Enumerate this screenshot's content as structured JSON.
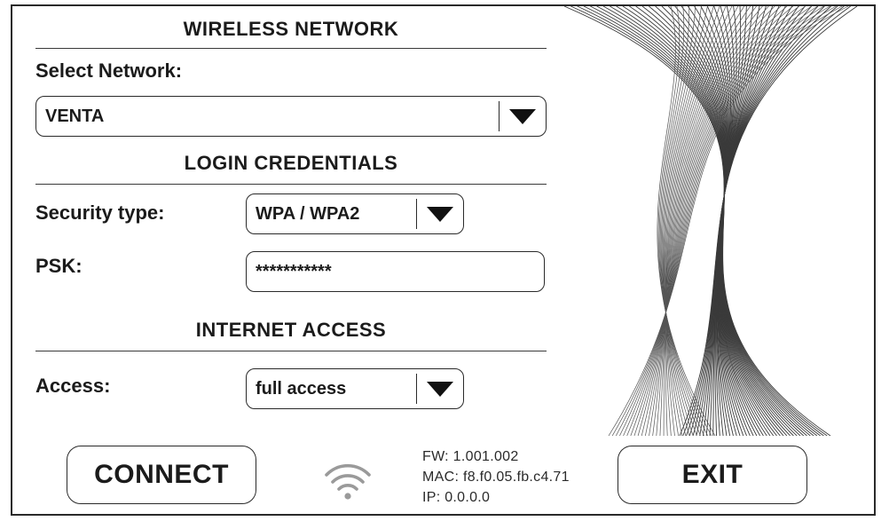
{
  "sections": {
    "wireless": "WIRELESS NETWORK",
    "login": "LOGIN CREDENTIALS",
    "internet": "INTERNET ACCESS"
  },
  "network": {
    "label": "Select Network:",
    "selected": "VENTA"
  },
  "security": {
    "label": "Security type:",
    "selected": "WPA / WPA2"
  },
  "psk": {
    "label": "PSK:",
    "value": "***********"
  },
  "access": {
    "label": "Access:",
    "selected": "full access"
  },
  "buttons": {
    "connect": "CONNECT",
    "exit": "EXIT"
  },
  "info": {
    "fw": "FW:  1.001.002",
    "mac": "MAC: f8.f0.05.fb.c4.71",
    "ip": "IP:   0.0.0.0"
  },
  "icons": {
    "wifi": "wifi-icon",
    "dropdown": "triangle-down-icon"
  },
  "colors": {
    "ink": "#1b1b1b",
    "wifi_gray": "#9a9a9a"
  }
}
